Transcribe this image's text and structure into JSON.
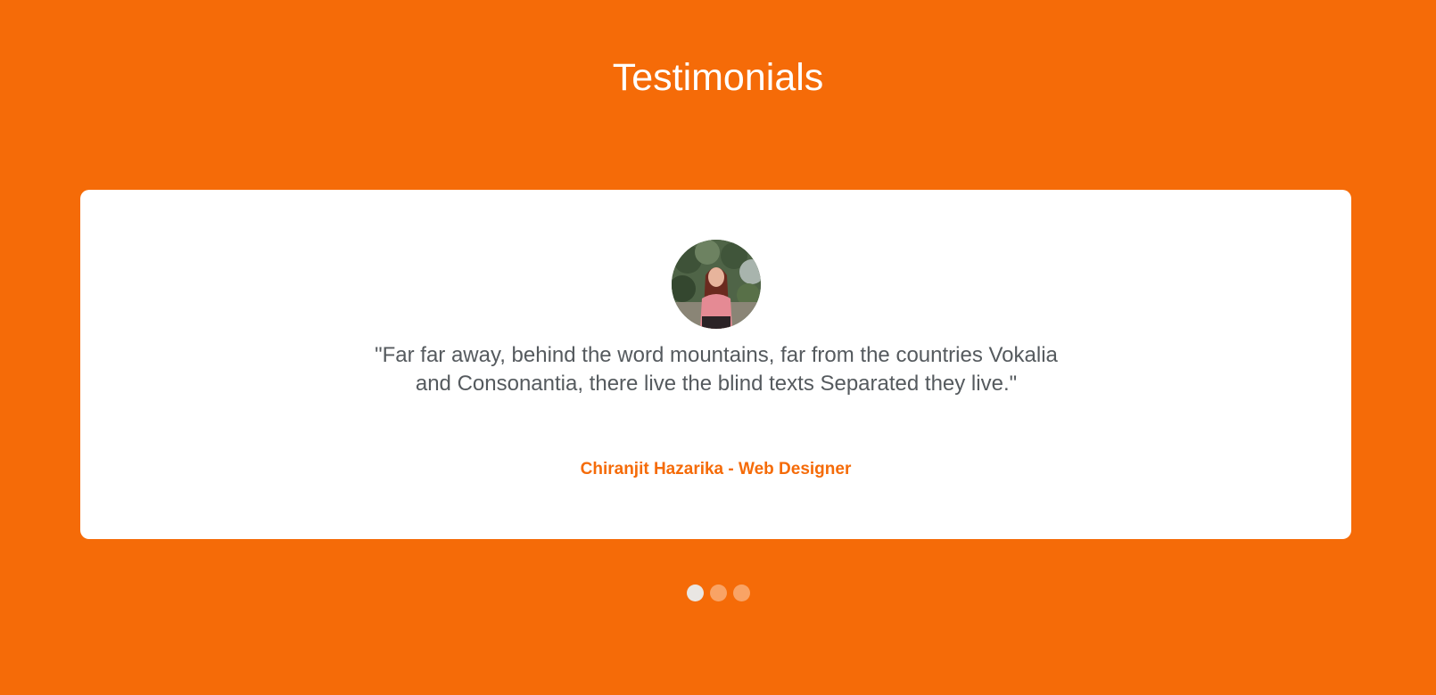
{
  "section": {
    "title": "Testimonials"
  },
  "testimonial": {
    "avatar_icon": "person-photo",
    "quote": "\"Far far away, behind the word mountains, far from the countries Vokalia and Consonantia, there live the blind texts Separated they live.\"",
    "author": "Chiranjit Hazarika - Web Designer"
  },
  "carousel": {
    "dot_count": 3,
    "active_index": 0
  },
  "colors": {
    "background": "#f56b08",
    "card": "#ffffff",
    "accent": "#f56b08",
    "text": "#555a5e"
  }
}
